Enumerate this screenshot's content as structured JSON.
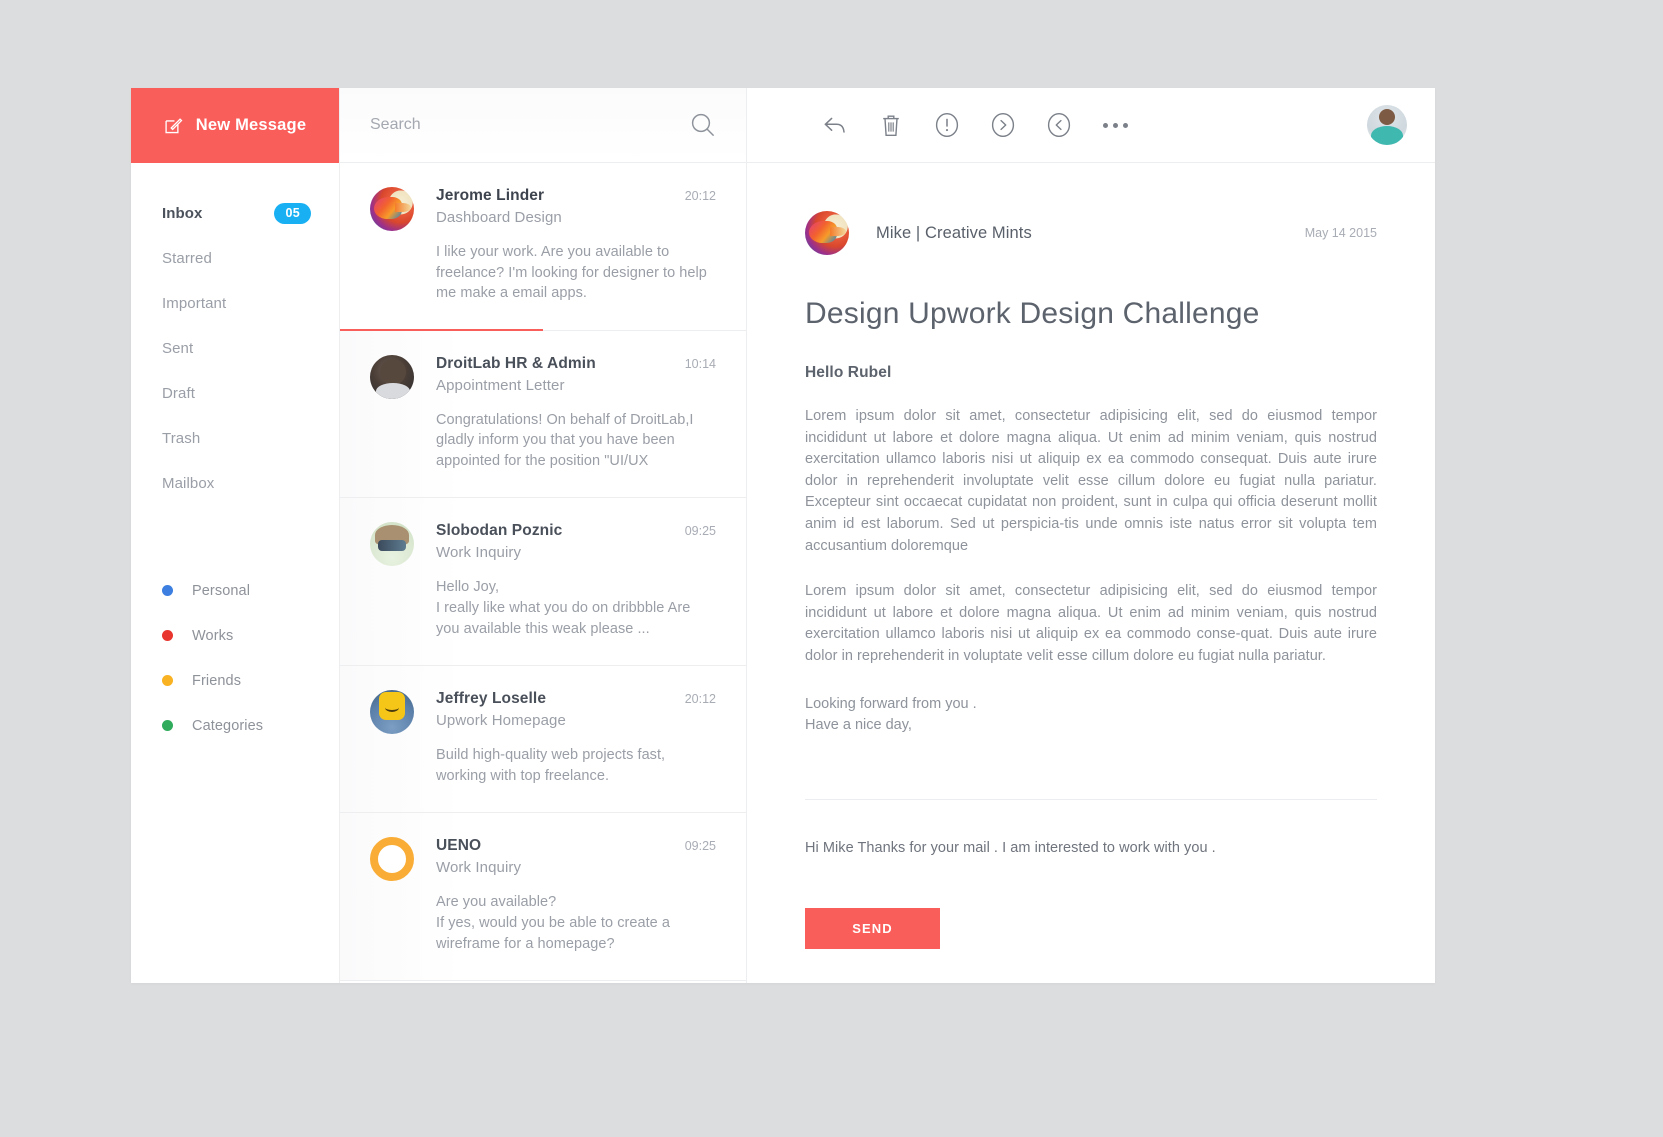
{
  "theme": {
    "accent": "#fa5e5b",
    "badge": "#19b0f3",
    "text_dark": "#4a505a",
    "text_muted": "#9a9ea6",
    "panel_bg": "#ffffff",
    "desktop_bg": "#dcdddf",
    "border": "#eceef0"
  },
  "sidebar": {
    "new_message": {
      "label": "New Message",
      "icon": "compose-icon"
    },
    "folders": [
      {
        "label": "Inbox",
        "badge": "05",
        "active": true
      },
      {
        "label": "Starred",
        "badge": "",
        "active": false
      },
      {
        "label": "Important",
        "badge": "",
        "active": false
      },
      {
        "label": "Sent",
        "badge": "",
        "active": false
      },
      {
        "label": "Draft",
        "badge": "",
        "active": false
      },
      {
        "label": "Trash",
        "badge": "",
        "active": false
      },
      {
        "label": "Mailbox",
        "badge": "",
        "active": false
      }
    ],
    "tags": [
      {
        "label": "Personal",
        "color": "#3c7fe0"
      },
      {
        "label": "Works",
        "color": "#e8352e"
      },
      {
        "label": "Friends",
        "color": "#f9b221"
      },
      {
        "label": "Categories",
        "color": "#2fab5b"
      }
    ]
  },
  "search": {
    "value": "",
    "placeholder": "Search",
    "icon": "search-icon"
  },
  "email_list": [
    {
      "sender": "Jerome Linder",
      "subject": "Dashboard Design",
      "time": "20:12",
      "snippet": "I like your work. Are you available to freelance? I'm looking for designer to help me make a email apps.",
      "selected": true,
      "avatar": "av-bird"
    },
    {
      "sender": "DroitLab HR & Admin",
      "subject": "Appointment Letter",
      "time": "10:14",
      "snippet": "Congratulations! On behalf of DroitLab,I gladly inform you that you have been appointed for the position \"UI/UX",
      "selected": false,
      "avatar": "av-man"
    },
    {
      "sender": "Slobodan Poznic",
      "subject": "Work Inquiry",
      "time": "09:25",
      "snippet": "Hello Joy,\nI really like what you do on dribbble Are you available this weak please ...",
      "selected": false,
      "avatar": "av-helmet"
    },
    {
      "sender": "Jeffrey Loselle",
      "subject": "Upwork Homepage",
      "time": "20:12",
      "snippet": "Build high-quality web projects fast, working with top freelance.",
      "selected": false,
      "avatar": "av-lego"
    },
    {
      "sender": "UENO",
      "subject": "Work Inquiry",
      "time": "09:25",
      "snippet": "Are you available?\nIf yes, would you be able to create a wireframe for a homepage?",
      "selected": false,
      "avatar": "av-ring"
    }
  ],
  "toolbar": {
    "buttons": [
      {
        "name": "reply-icon",
        "title": "Reply"
      },
      {
        "name": "trash-icon",
        "title": "Delete"
      },
      {
        "name": "spam-icon",
        "title": "Mark as spam"
      },
      {
        "name": "next-icon",
        "title": "Next"
      },
      {
        "name": "previous-icon",
        "title": "Previous"
      },
      {
        "name": "more-options-icon",
        "title": "More"
      }
    ],
    "avatar": "user-avatar"
  },
  "message": {
    "from": "Mike | Creative Mints",
    "date": "May 14 2015",
    "title": "Design Upwork Design Challenge",
    "greeting": "Hello Rubel",
    "paragraph_1": "Lorem ipsum dolor sit amet, consectetur adipisicing elit, sed do eiusmod tempor incididunt ut labore et dolore magna aliqua. Ut enim ad minim veniam, quis nostrud exercitation ullamco laboris nisi ut aliquip ex ea commodo consequat. Duis aute irure dolor in reprehenderit involuptate velit esse cillum dolore eu fugiat nulla pariatur. Excepteur sint occaecat cupidatat non proident, sunt in culpa qui officia deserunt mollit anim id est laborum. Sed ut perspicia-tis unde omnis iste natus error sit volupta tem accusantium doloremque",
    "paragraph_2": "Lorem ipsum dolor sit amet, consectetur adipisicing elit, sed do eiusmod tempor incididunt ut labore et dolore magna aliqua. Ut enim ad minim veniam, quis nostrud exercitation ullamco laboris nisi ut aliquip ex ea commodo conse-quat. Duis aute irure dolor in reprehenderit in voluptate velit esse cillum dolore eu fugiat nulla pariatur.",
    "signoff_line_1": "Looking forward from you .",
    "signoff_line_2": "Have a nice day,",
    "avatar": "av-bird"
  },
  "reply": {
    "text": "Hi Mike Thanks for your mail . I am interested to work with you .",
    "send_label": "SEND"
  }
}
